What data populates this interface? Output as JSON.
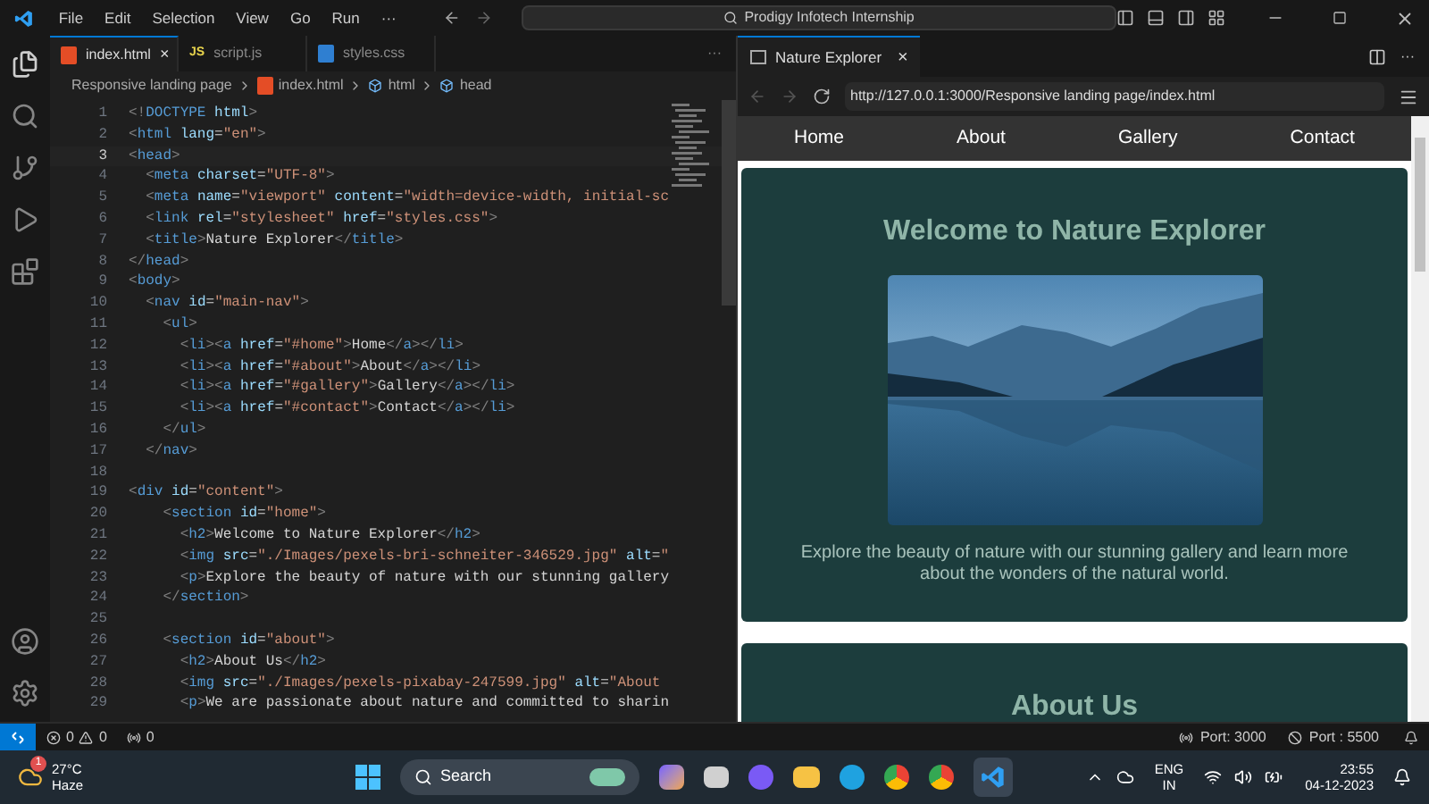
{
  "title_bar": {
    "menus": [
      "File",
      "Edit",
      "Selection",
      "View",
      "Go",
      "Run",
      "···"
    ],
    "search": "Prodigy Infotech Internship"
  },
  "editor_tabs": [
    {
      "label": "index.html",
      "kind": "html",
      "selected": true,
      "close": "×"
    },
    {
      "label": "script.js",
      "kind": "js",
      "badge": "JS",
      "selected": false
    },
    {
      "label": "styles.css",
      "kind": "css",
      "selected": false
    }
  ],
  "editor_tabs_more": "···",
  "breadcrumbs": [
    "Responsive landing page",
    "index.html",
    "html",
    "head"
  ],
  "code": [
    {
      "number": "1",
      "text": "<!DOCTYPE html>"
    },
    {
      "number": "2",
      "text": "<html lang=\"en\">"
    },
    {
      "number": "3",
      "text": "<head>"
    },
    {
      "number": "4",
      "text": "  <meta charset=\"UTF-8\">"
    },
    {
      "number": "5",
      "text": "  <meta name=\"viewport\" content=\"width=device-width, initial-sc"
    },
    {
      "number": "6",
      "text": "  <link rel=\"stylesheet\" href=\"styles.css\">"
    },
    {
      "number": "7",
      "text": "  <title>Nature Explorer</title>"
    },
    {
      "number": "8",
      "text": "</head>"
    },
    {
      "number": "9",
      "text": "<body>"
    },
    {
      "number": "10",
      "text": "  <nav id=\"main-nav\">"
    },
    {
      "number": "11",
      "text": "    <ul>"
    },
    {
      "number": "12",
      "text": "      <li><a href=\"#home\">Home</a></li>"
    },
    {
      "number": "13",
      "text": "      <li><a href=\"#about\">About</a></li>"
    },
    {
      "number": "14",
      "text": "      <li><a href=\"#gallery\">Gallery</a></li>"
    },
    {
      "number": "15",
      "text": "      <li><a href=\"#contact\">Contact</a></li>"
    },
    {
      "number": "16",
      "text": "    </ul>"
    },
    {
      "number": "17",
      "text": "  </nav>"
    },
    {
      "number": "18"
    },
    {
      "number": "19",
      "text": "<div id=\"content\">"
    },
    {
      "number": "20",
      "text": "    <section id=\"home\">"
    },
    {
      "number": "21",
      "text": "      <h2>Welcome to Nature Explorer</h2>"
    },
    {
      "number": "22",
      "text": "      <img src=\"./Images/pexels-bri-schneiter-346529.jpg\" alt=\""
    },
    {
      "number": "23",
      "text": "      <p>Explore the beauty of nature with our stunning gallery"
    },
    {
      "number": "24",
      "text": "    </section>"
    },
    {
      "number": "25"
    },
    {
      "number": "26",
      "text": "    <section id=\"about\">"
    },
    {
      "number": "27",
      "text": "      <h2>About Us</h2>"
    },
    {
      "number": "28",
      "text": "      <img src=\"./Images/pexels-pixabay-247599.jpg\" alt=\"About"
    },
    {
      "number": "29",
      "text": "      <p>We are passionate about nature and committed to sharin"
    }
  ],
  "browser": {
    "tab": {
      "label": "Nature Explorer",
      "close": "×",
      "selected": true
    },
    "url": "http://127.0.0.1:3000/Responsive landing page/index.html",
    "nav": [
      "Home",
      "About",
      "Gallery",
      "Contact"
    ],
    "sections": [
      {
        "heading": "Welcome to Nature Explorer",
        "has_image": true,
        "text": "Explore the beauty of nature with our stunning gallery and learn more about the wonders of the natural world."
      },
      {
        "heading": "About Us",
        "has_image": false
      }
    ]
  },
  "status_bar": {
    "errors": "0",
    "warnings": "0",
    "ports": "0",
    "port_a": "Port: 3000",
    "port_b": "Port : 5500"
  },
  "taskbar": {
    "temperature": "27°C",
    "weather": "Haze",
    "weather_badge": "1",
    "search": "Search",
    "language": "ENG",
    "region": "IN",
    "time": "23:55",
    "date": "04-12-2023"
  }
}
